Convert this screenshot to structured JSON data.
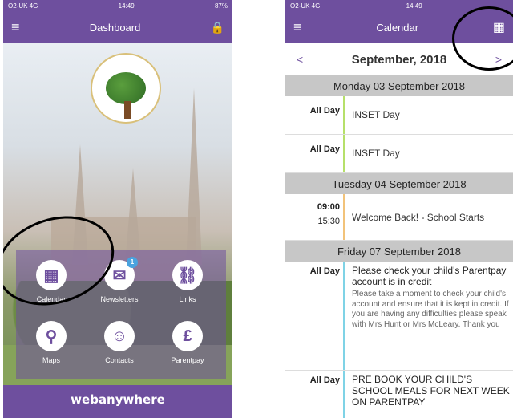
{
  "left": {
    "status": {
      "carrier": "O2-UK 4G",
      "time": "14:49",
      "battery": "87%"
    },
    "title": "Dashboard",
    "tiles": [
      {
        "label": "Calendar",
        "icon": "calendar-icon",
        "glyph": "▦"
      },
      {
        "label": "Newsletters",
        "icon": "envelope-icon",
        "glyph": "✉",
        "badge": "1"
      },
      {
        "label": "Links",
        "icon": "link-icon",
        "glyph": "⛓"
      },
      {
        "label": "Maps",
        "icon": "map-pin-icon",
        "glyph": "⚲"
      },
      {
        "label": "Contacts",
        "icon": "people-icon",
        "glyph": "☺"
      },
      {
        "label": "Parentpay",
        "icon": "pound-icon",
        "glyph": "£"
      }
    ],
    "footer_brand": "webanywhere",
    "colors": {
      "purple": "#6e4f9e"
    }
  },
  "right": {
    "status": {
      "carrier": "O2-UK 4G",
      "time": "14:49"
    },
    "title": "Calendar",
    "month": "September, 2018",
    "prev": "<",
    "next": ">",
    "days": [
      {
        "header": "Monday 03 September 2018",
        "events": [
          {
            "time": "All Day",
            "title": "INSET Day",
            "color": "#b6e06a"
          },
          {
            "time": "All Day",
            "title": "INSET Day",
            "color": "#b6e06a"
          }
        ]
      },
      {
        "header": "Tuesday 04 September 2018",
        "events": [
          {
            "time": "09:00",
            "time2": "15:30",
            "title": "Welcome Back! - School Starts",
            "color": "#f2c37a"
          }
        ]
      },
      {
        "header": "Friday 07 September 2018",
        "events": [
          {
            "time": "All Day",
            "title": "Please check your child's Parentpay account is in credit",
            "body": "Please take a moment to check your child's account and ensure that it is kept in credit. If you are having any difficulties please speak with Mrs Hunt or Mrs McLeary. Thank you",
            "color": "#7fd3e6"
          },
          {
            "time": "All Day",
            "title": "PRE BOOK YOUR CHILD'S SCHOOL MEALS FOR NEXT WEEK ON PARENTPAY",
            "color": "#7fd3e6"
          }
        ]
      }
    ]
  }
}
